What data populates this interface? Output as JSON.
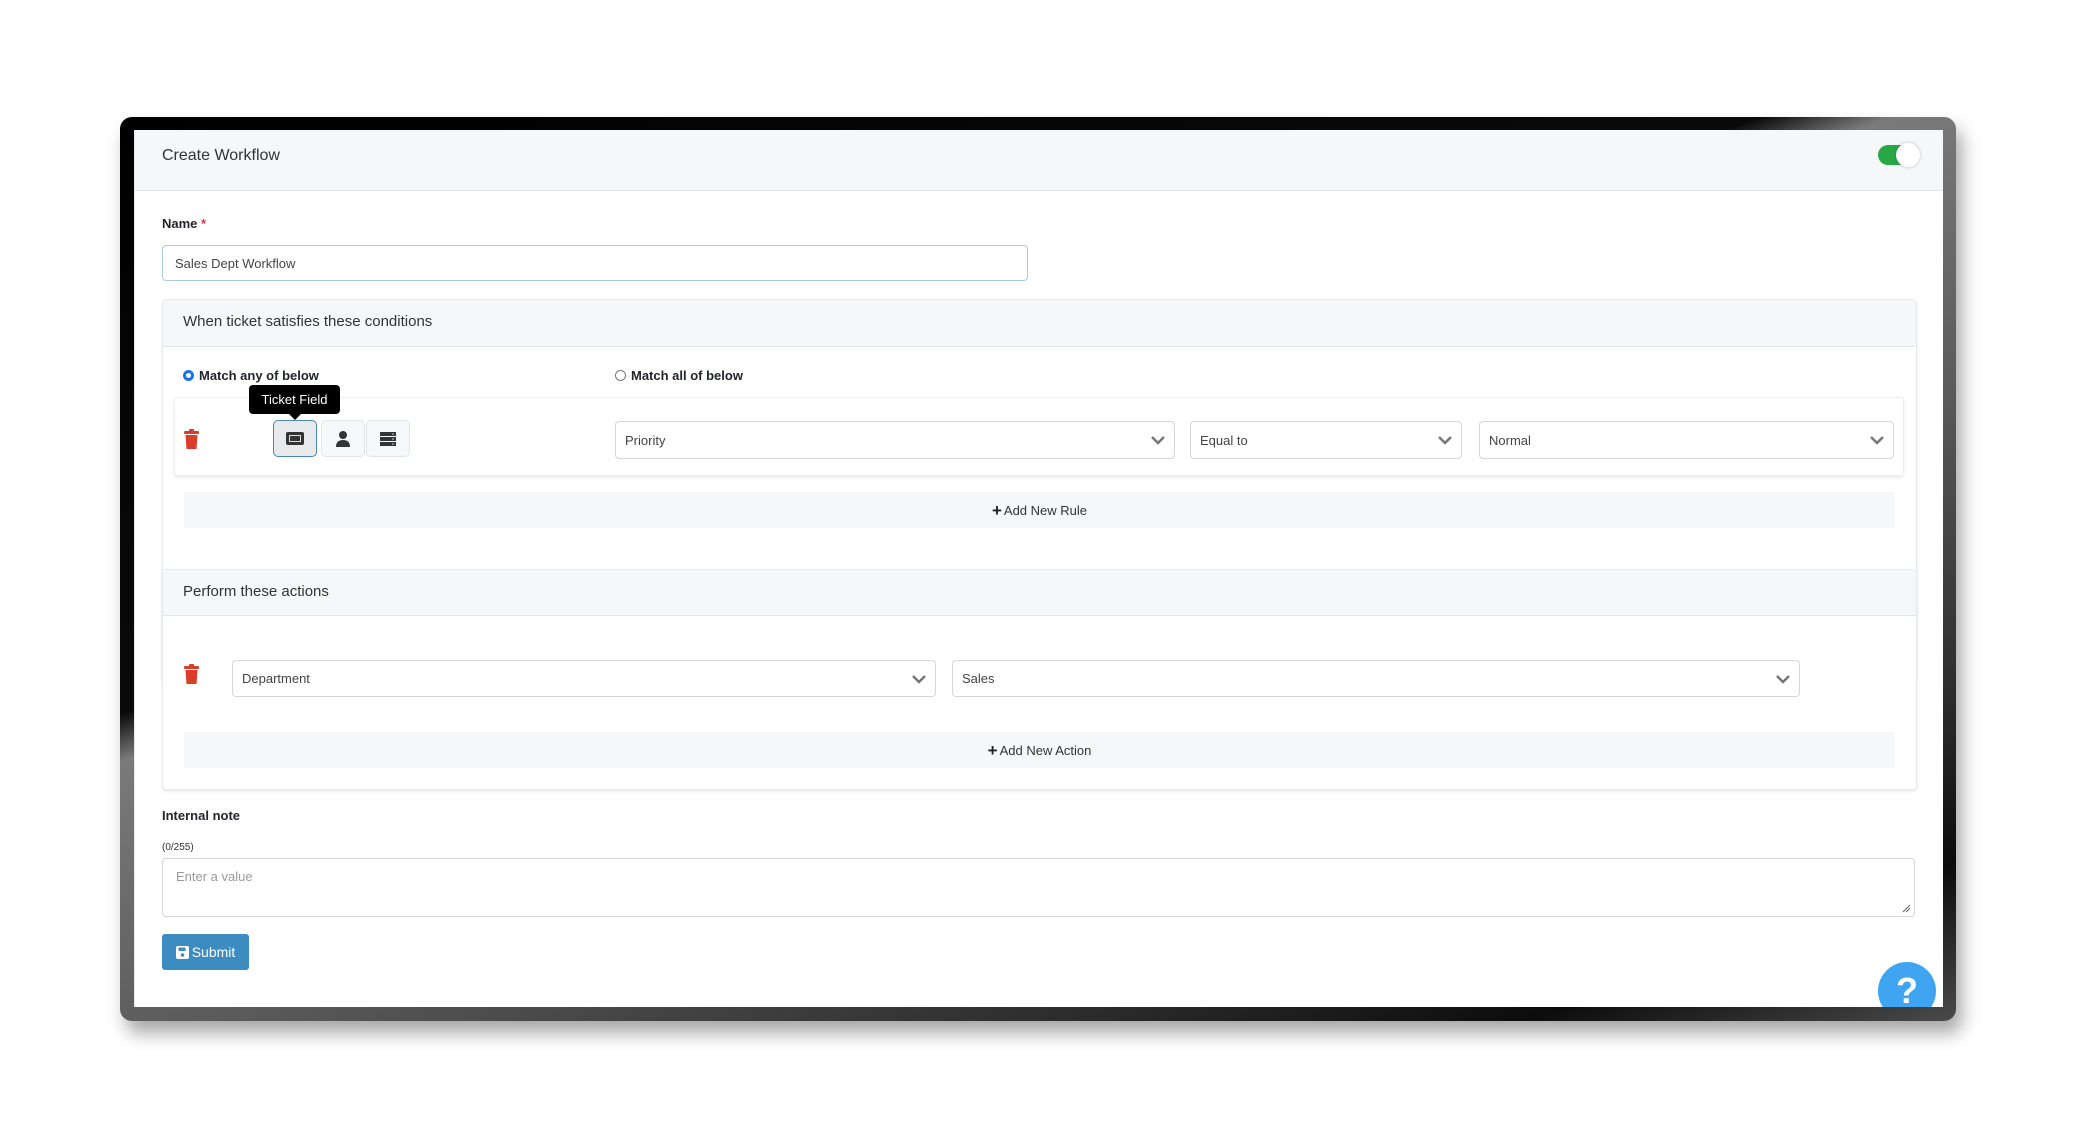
{
  "header": {
    "title": "Create Workflow",
    "enabled": true,
    "toggle_color": "#28a745"
  },
  "name_field": {
    "label": "Name",
    "required_mark": "*",
    "value": "Sales Dept Workflow"
  },
  "conditions": {
    "title": "When ticket satisfies these conditions",
    "match_options": [
      {
        "label": "Match any of below",
        "selected": true
      },
      {
        "label": "Match all of below",
        "selected": false
      }
    ],
    "rules": [
      {
        "type_buttons": [
          {
            "icon": "ticket-icon",
            "tooltip": "Ticket Field",
            "active": true
          },
          {
            "icon": "user-icon",
            "active": false
          },
          {
            "icon": "server-icon",
            "active": false
          }
        ],
        "field": "Priority",
        "operator": "Equal to",
        "value": "Normal"
      }
    ],
    "add_label": "Add New Rule"
  },
  "actions": {
    "title": "Perform these actions",
    "items": [
      {
        "field": "Department",
        "value": "Sales"
      }
    ],
    "add_label": "Add New Action"
  },
  "internal_note": {
    "label": "Internal note",
    "counter": "(0/255)",
    "placeholder": "Enter a value",
    "value": ""
  },
  "submit": {
    "label": "Submit",
    "color": "#3d8cc1"
  },
  "help": {
    "label": "?",
    "color": "#3fa5f3"
  },
  "colors": {
    "danger": "#dc3c2a",
    "accent": "#1a73e8"
  }
}
